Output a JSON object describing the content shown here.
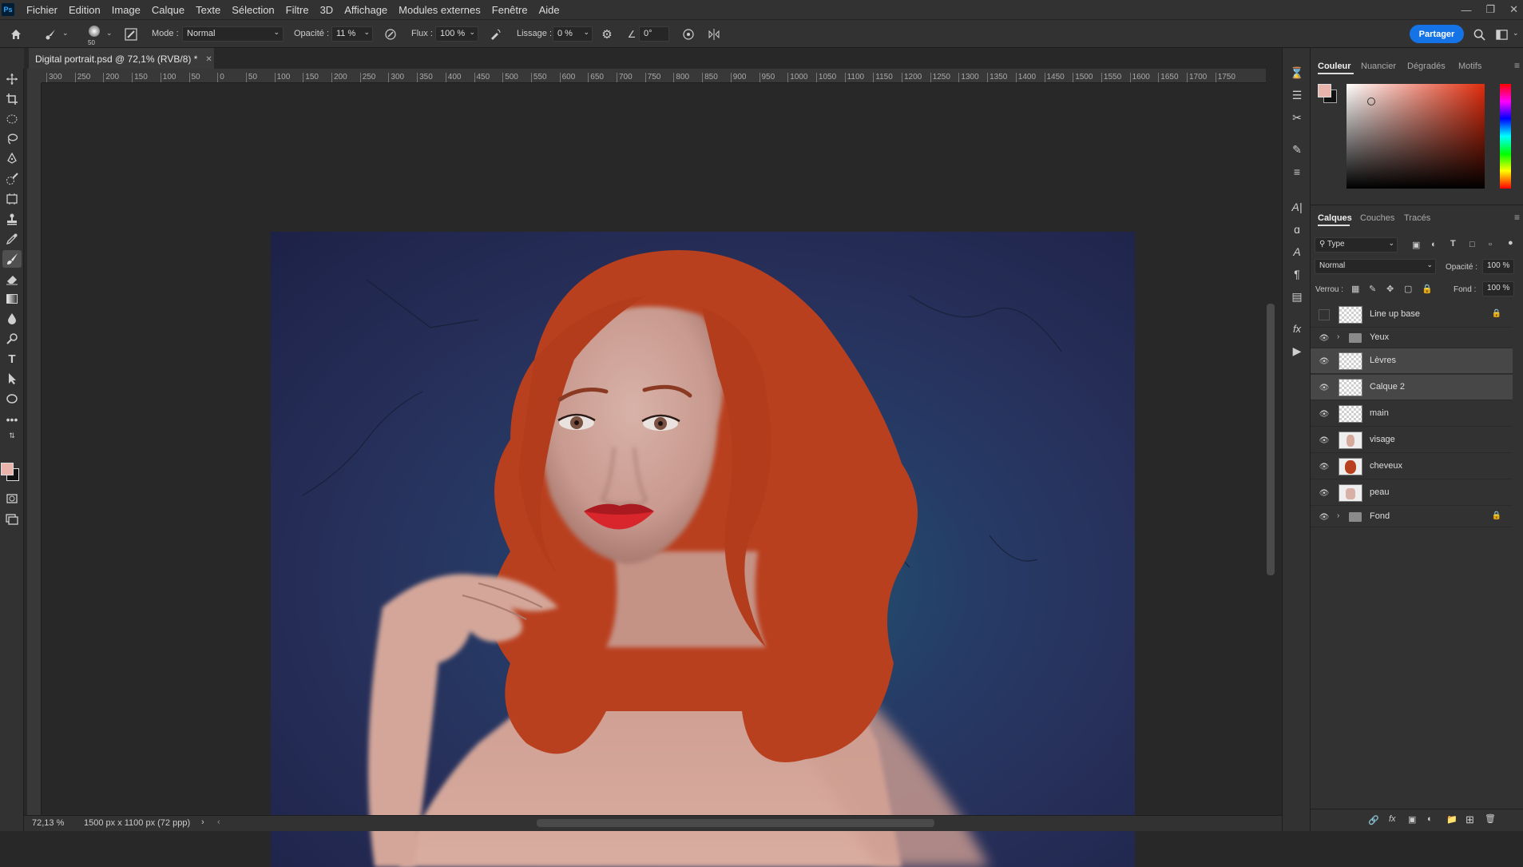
{
  "menubar": {
    "app_icon": "Ps",
    "items": [
      "Fichier",
      "Edition",
      "Image",
      "Calque",
      "Texte",
      "Sélection",
      "Filtre",
      "3D",
      "Affichage",
      "Modules externes",
      "Fenêtre",
      "Aide"
    ]
  },
  "options": {
    "brush_size": "50",
    "mode_label": "Mode :",
    "mode_value": "Normal",
    "opacity_label": "Opacité :",
    "opacity_value": "11 %",
    "flow_label": "Flux :",
    "flow_value": "100 %",
    "smoothing_label": "Lissage :",
    "smoothing_value": "0 %",
    "angle_value": "0°",
    "share_label": "Partager"
  },
  "document": {
    "tab_title": "Digital portrait.psd @ 72,1% (RVB/8) *",
    "zoom": "72,13 %",
    "dimensions": "1500 px x 1100 px (72 ppp)"
  },
  "ruler_ticks": [
    "300",
    "250",
    "200",
    "150",
    "100",
    "50",
    "0",
    "50",
    "100",
    "150",
    "200",
    "250",
    "300",
    "350",
    "400",
    "450",
    "500",
    "550",
    "600",
    "650",
    "700",
    "750",
    "800",
    "850",
    "900",
    "950",
    "1000",
    "1050",
    "1100",
    "1150",
    "1200",
    "1250",
    "1300",
    "1350",
    "1400",
    "1450",
    "1500",
    "1550",
    "1600",
    "1650",
    "1700",
    "1750"
  ],
  "color_panel": {
    "tabs": [
      "Couleur",
      "Nuancier",
      "Dégradés",
      "Motifs"
    ],
    "foreground": "#e8b4ac",
    "background": "#111111"
  },
  "layers_panel": {
    "tabs": [
      "Calques",
      "Couches",
      "Tracés"
    ],
    "filter_label": "Type",
    "blend_mode": "Normal",
    "opacity_label": "Opacité :",
    "opacity_value": "100 %",
    "lock_label": "Verrou :",
    "fill_label": "Fond :",
    "fill_value": "100 %",
    "layers": [
      {
        "name": "Line up base",
        "visible": false,
        "locked": true,
        "group": false
      },
      {
        "name": "Yeux",
        "visible": true,
        "locked": false,
        "group": true
      },
      {
        "name": "Lèvres",
        "visible": true,
        "locked": false,
        "group": false,
        "selected": true
      },
      {
        "name": "Calque 2",
        "visible": true,
        "locked": false,
        "group": false,
        "selected": true
      },
      {
        "name": "main",
        "visible": true,
        "locked": false,
        "group": false
      },
      {
        "name": "visage",
        "visible": true,
        "locked": false,
        "group": false
      },
      {
        "name": "cheveux",
        "visible": true,
        "locked": false,
        "group": false
      },
      {
        "name": "peau",
        "visible": true,
        "locked": false,
        "group": false
      },
      {
        "name": "Fond",
        "visible": true,
        "locked": true,
        "group": true
      }
    ]
  }
}
